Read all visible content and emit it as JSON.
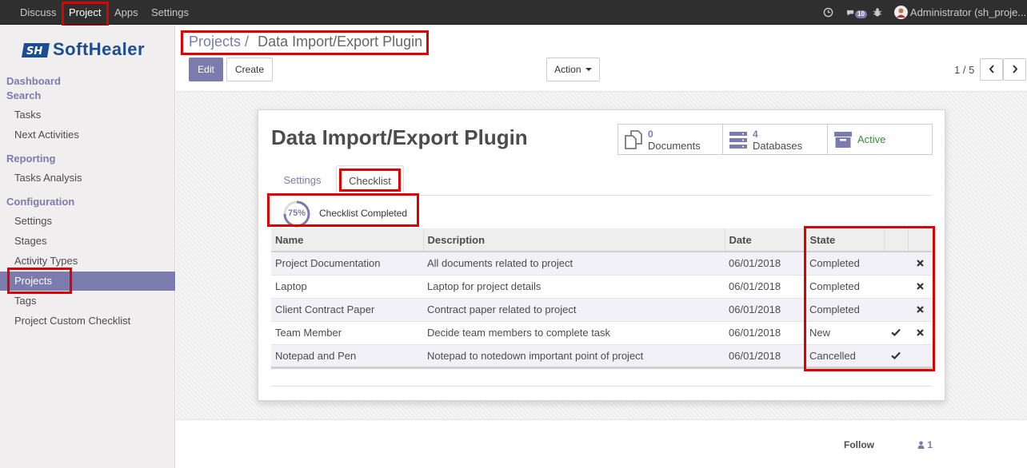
{
  "topnav": {
    "menu": [
      "Discuss",
      "Project",
      "Apps",
      "Settings"
    ],
    "messages_count": "10",
    "user": "Administrator (sh_proje..."
  },
  "sidebar": {
    "logo_text": "SoftHealer",
    "sections": [
      {
        "title": "Dashboard",
        "items": []
      },
      {
        "title": "Search",
        "items": [
          "Tasks",
          "Next Activities"
        ]
      },
      {
        "title": "Reporting",
        "items": [
          "Tasks Analysis"
        ]
      },
      {
        "title": "Configuration",
        "items": [
          "Settings",
          "Stages",
          "Activity Types",
          "Projects",
          "Tags",
          "Project Custom Checklist"
        ]
      }
    ],
    "active_item": "Projects"
  },
  "control_panel": {
    "breadcrumb_parent": "Projects",
    "breadcrumb_separator": "/",
    "breadcrumb_current": "Data Import/Export Plugin",
    "edit_label": "Edit",
    "create_label": "Create",
    "action_label": "Action",
    "pager": "1 / 5"
  },
  "form": {
    "title": "Data Import/Export Plugin",
    "stats": [
      {
        "value": "0",
        "label": "Documents"
      },
      {
        "value": "4",
        "label": "Databases"
      },
      {
        "value": "",
        "label": "Active"
      }
    ],
    "tabs": [
      "Settings",
      "Checklist"
    ],
    "active_tab": "Checklist",
    "progress_percent": 75,
    "progress_label": "75%",
    "progress_text": "Checklist Completed",
    "table": {
      "headers": [
        "Name",
        "Description",
        "Date",
        "State"
      ],
      "rows": [
        {
          "name": "Project Documentation",
          "description": "All documents related to project",
          "date": "06/01/2018",
          "state": "Completed",
          "check": false,
          "remove": true
        },
        {
          "name": "Laptop",
          "description": "Laptop for project details",
          "date": "06/01/2018",
          "state": "Completed",
          "check": false,
          "remove": true
        },
        {
          "name": "Client Contract Paper",
          "description": "Contract paper related to project",
          "date": "06/01/2018",
          "state": "Completed",
          "check": false,
          "remove": true
        },
        {
          "name": "Team Member",
          "description": "Decide team members to complete task",
          "date": "06/01/2018",
          "state": "New",
          "check": true,
          "remove": true
        },
        {
          "name": "Notepad and Pen",
          "description": "Notepad to notedown important point of project",
          "date": "06/01/2018",
          "state": "Cancelled",
          "check": true,
          "remove": false
        }
      ]
    }
  },
  "chatter": {
    "follow_label": "Follow",
    "followers_count": "1"
  },
  "colors": {
    "accent": "#7c7bad",
    "topbar": "#2f2f2f",
    "highlight": "#e00000"
  }
}
